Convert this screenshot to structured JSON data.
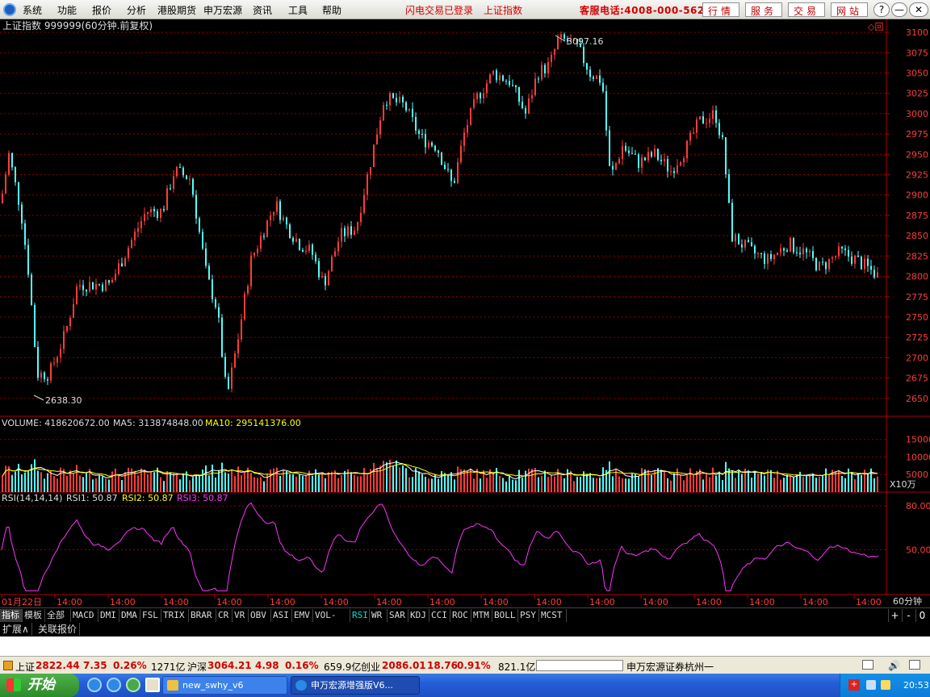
{
  "menubar": {
    "items": [
      "系统",
      "功能",
      "报价",
      "分析",
      "港股期货",
      "申万宏源",
      "资讯",
      "工具",
      "帮助"
    ],
    "login_status": "闪电交易已登录",
    "index_name": "上证指数",
    "hotline": "客服电话:4008-000-562",
    "buttons": [
      "行情",
      "服务",
      "交易",
      "网站"
    ],
    "window_buttons": [
      "?",
      "—",
      "❐",
      "✕"
    ]
  },
  "chart_data": {
    "type": "candlestick",
    "title": "上证指数 999999(60分钟.前复权)",
    "price_axis": {
      "ticks": [
        3100,
        3075,
        3050,
        3025,
        3000,
        2975,
        2950,
        2925,
        2900,
        2875,
        2850,
        2825,
        2800,
        2775,
        2750,
        2725,
        2700,
        2675,
        2650
      ],
      "range": [
        2630,
        3108
      ]
    },
    "high_marker": "3097.16",
    "low_marker": "2638.30",
    "trend_points": [
      [
        0,
        2890
      ],
      [
        10,
        2950
      ],
      [
        25,
        2880
      ],
      [
        35,
        2800
      ],
      [
        45,
        2680
      ],
      [
        60,
        2680
      ],
      [
        80,
        2730
      ],
      [
        95,
        2790
      ],
      [
        110,
        2790
      ],
      [
        135,
        2790
      ],
      [
        150,
        2820
      ],
      [
        180,
        2880
      ],
      [
        200,
        2880
      ],
      [
        215,
        2930
      ],
      [
        235,
        2920
      ],
      [
        255,
        2800
      ],
      [
        268,
        2760
      ],
      [
        280,
        2650
      ],
      [
        295,
        2730
      ],
      [
        310,
        2820
      ],
      [
        340,
        2890
      ],
      [
        355,
        2860
      ],
      [
        370,
        2840
      ],
      [
        385,
        2830
      ],
      [
        400,
        2790
      ],
      [
        420,
        2850
      ],
      [
        440,
        2860
      ],
      [
        460,
        2950
      ],
      [
        475,
        3020
      ],
      [
        500,
        3010
      ],
      [
        520,
        2970
      ],
      [
        540,
        2960
      ],
      [
        560,
        2910
      ],
      [
        575,
        2980
      ],
      [
        590,
        3020
      ],
      [
        610,
        3050
      ],
      [
        630,
        3040
      ],
      [
        650,
        3000
      ],
      [
        665,
        3050
      ],
      [
        680,
        3060
      ],
      [
        690,
        3090
      ],
      [
        700,
        3090
      ],
      [
        715,
        3080
      ],
      [
        730,
        3050
      ],
      [
        745,
        3040
      ],
      [
        755,
        2920
      ],
      [
        770,
        2960
      ],
      [
        790,
        2940
      ],
      [
        810,
        2950
      ],
      [
        830,
        2930
      ],
      [
        850,
        2960
      ],
      [
        865,
        2990
      ],
      [
        885,
        3000
      ],
      [
        895,
        2960
      ],
      [
        905,
        2850
      ],
      [
        930,
        2830
      ],
      [
        950,
        2820
      ],
      [
        975,
        2840
      ],
      [
        995,
        2830
      ],
      [
        1015,
        2810
      ],
      [
        1040,
        2830
      ],
      [
        1060,
        2820
      ],
      [
        1088,
        2800
      ]
    ],
    "volume": {
      "label": "VOLUME: 418620672.00",
      "ma5": "MA5: 313874848.00",
      "ma10": "MA10: 295141376.00",
      "ticks": [
        "15000",
        "10000",
        "5000"
      ],
      "unit": "X10万"
    },
    "rsi": {
      "label": "RSI(14,14,14)",
      "rsi1": "RSI1: 50.87",
      "rsi2": "RSI2: 50.87",
      "rsi3": "RSI3: 50.87",
      "ticks": [
        "80.00",
        "50.00"
      ]
    },
    "time_labels": [
      "01月22日",
      "14:00",
      "14:00",
      "14:00",
      "14:00",
      "14:00",
      "14:00",
      "14:00",
      "14:00",
      "14:00",
      "14:00",
      "14:00",
      "14:00",
      "14:00",
      "14:00",
      "14:00",
      "14:00",
      "14:00"
    ],
    "period": "60分钟"
  },
  "tabs": {
    "items": [
      "指标",
      "模板",
      "全部",
      "MACD",
      "DMI",
      "DMA",
      "FSL",
      "TRIX",
      "BRAR",
      "CR",
      "VR",
      "OBV",
      "ASI",
      "EMV",
      "VOL-TDX",
      "RSI",
      "WR",
      "SAR",
      "KDJ",
      "CCI",
      "ROC",
      "MTM",
      "BOLL",
      "PSY",
      "MCST"
    ],
    "active": "RSI",
    "controls": [
      "+",
      "-",
      "0"
    ]
  },
  "ext_tabs": [
    "扩展∧",
    "关联报价"
  ],
  "status": {
    "sh_name": "上证",
    "sh_value": "2822.44",
    "sh_change": "7.35",
    "sh_pct": "0.26%",
    "sh_amount": "1271亿",
    "hs_name": "沪深",
    "hs_value": "3064.21",
    "hs_change": "4.98",
    "hs_pct": "0.16%",
    "hs_amount": "659.9亿",
    "cy_name": "创业",
    "cy_value": "2086.01",
    "cy_change": "18.76",
    "cy_pct": "0.91%",
    "cy_amount": "821.1亿",
    "broker": "申万宏源证券杭州一"
  },
  "taskbar": {
    "start_label": "开始",
    "tasks": [
      "new_swhy_v6",
      "申万宏源增强版V6..."
    ],
    "clock": "20:53"
  },
  "colors": {
    "up": "#ff3c3c",
    "down": "#54ffff",
    "ma5": "#ffffff",
    "ma10": "#ffff00",
    "rsi": "#ff33ff",
    "grid": "#8b0000"
  }
}
